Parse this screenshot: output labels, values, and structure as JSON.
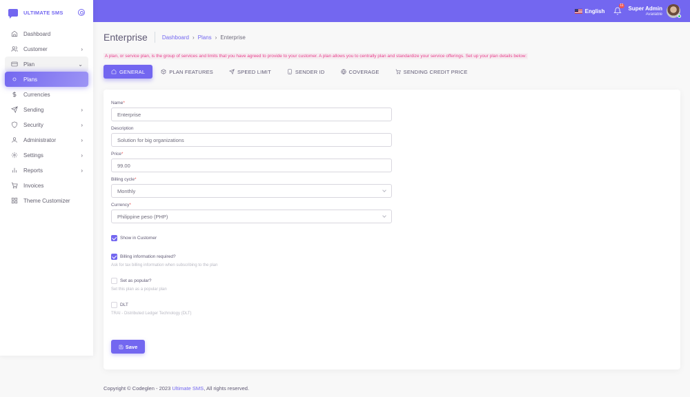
{
  "brand": {
    "name": "ULTIMATE SMS"
  },
  "sidebar": {
    "items": [
      {
        "label": "Dashboard",
        "icon": "home-icon"
      },
      {
        "label": "Customer",
        "icon": "users-icon"
      },
      {
        "label": "Plan",
        "icon": "credit-card-icon"
      },
      {
        "label": "Plans",
        "icon": "circle-icon"
      },
      {
        "label": "Currencies",
        "icon": "dollar-icon"
      },
      {
        "label": "Sending",
        "icon": "send-icon"
      },
      {
        "label": "Security",
        "icon": "shield-icon"
      },
      {
        "label": "Administrator",
        "icon": "user-icon"
      },
      {
        "label": "Settings",
        "icon": "gear-icon"
      },
      {
        "label": "Reports",
        "icon": "bar-chart-icon"
      },
      {
        "label": "Invoices",
        "icon": "cart-icon"
      },
      {
        "label": "Theme Customizer",
        "icon": "grid-icon"
      }
    ]
  },
  "navbar": {
    "language": "English",
    "notification_count": "11",
    "user_name": "Super Admin",
    "user_status": "Available"
  },
  "page": {
    "title": "Enterprise",
    "breadcrumb": [
      "Dashboard",
      "Plans",
      "Enterprise"
    ],
    "intro": "A plan, or service plan, is the group of services and limits that you have agreed to provide to your customer. A plan allows you to centrally plan and standardize your service offerings. Set up your plan details below:"
  },
  "tabs": [
    "GENERAL",
    "PLAN FEATURES",
    "SPEED LIMIT",
    "SENDER ID",
    "COVERAGE",
    "SENDING CREDIT PRICE"
  ],
  "form": {
    "name": {
      "label": "Name",
      "value": "Enterprise"
    },
    "description": {
      "label": "Description",
      "value": "Solution for big organizations"
    },
    "price": {
      "label": "Price",
      "value": "99.00"
    },
    "billing_cycle": {
      "label": "Billing cycle",
      "value": "Monthly"
    },
    "currency": {
      "label": "Currency",
      "value": "Philippine peso (PHP)"
    },
    "show_in_customer": {
      "label": "Show in Customer",
      "checked": true
    },
    "billing_info": {
      "label": "Billing information required?",
      "help": "Ask for tax billing information when subscribing to the plan",
      "checked": true
    },
    "popular": {
      "label": "Set as popular?",
      "help": "Set this plan as a popular plan",
      "checked": false
    },
    "dlt": {
      "label": "DLT",
      "help": "TRAI - Distributed Ledger Technology (DLT)",
      "checked": false
    },
    "save_label": "Save"
  },
  "footer": {
    "copyright": "Copyright © Codeglen - 2023",
    "link": "Ultimate SMS",
    "suffix": ", All rights reserved."
  },
  "colors": {
    "accent": "#7367f0",
    "danger": "#ea5455",
    "intro_text": "#e83e8c"
  }
}
